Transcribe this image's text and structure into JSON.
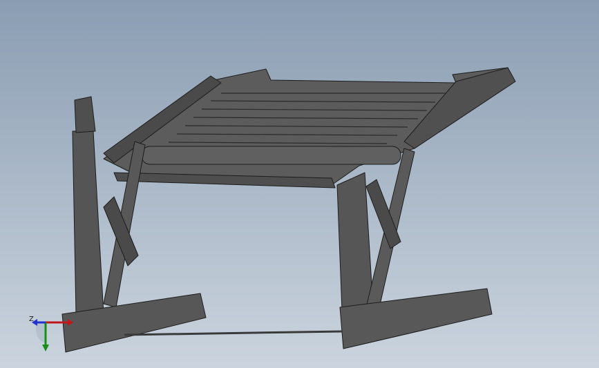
{
  "viewport": {
    "background_top": "#8a9db2",
    "background_bottom": "#c9d3de",
    "model_color": "#5a5a5a",
    "edge_color": "#1c1c1c"
  },
  "triad": {
    "z_label": "Z",
    "x_color": "#c0161c",
    "y_color": "#1a8c1a",
    "z_color": "#2233cc"
  }
}
